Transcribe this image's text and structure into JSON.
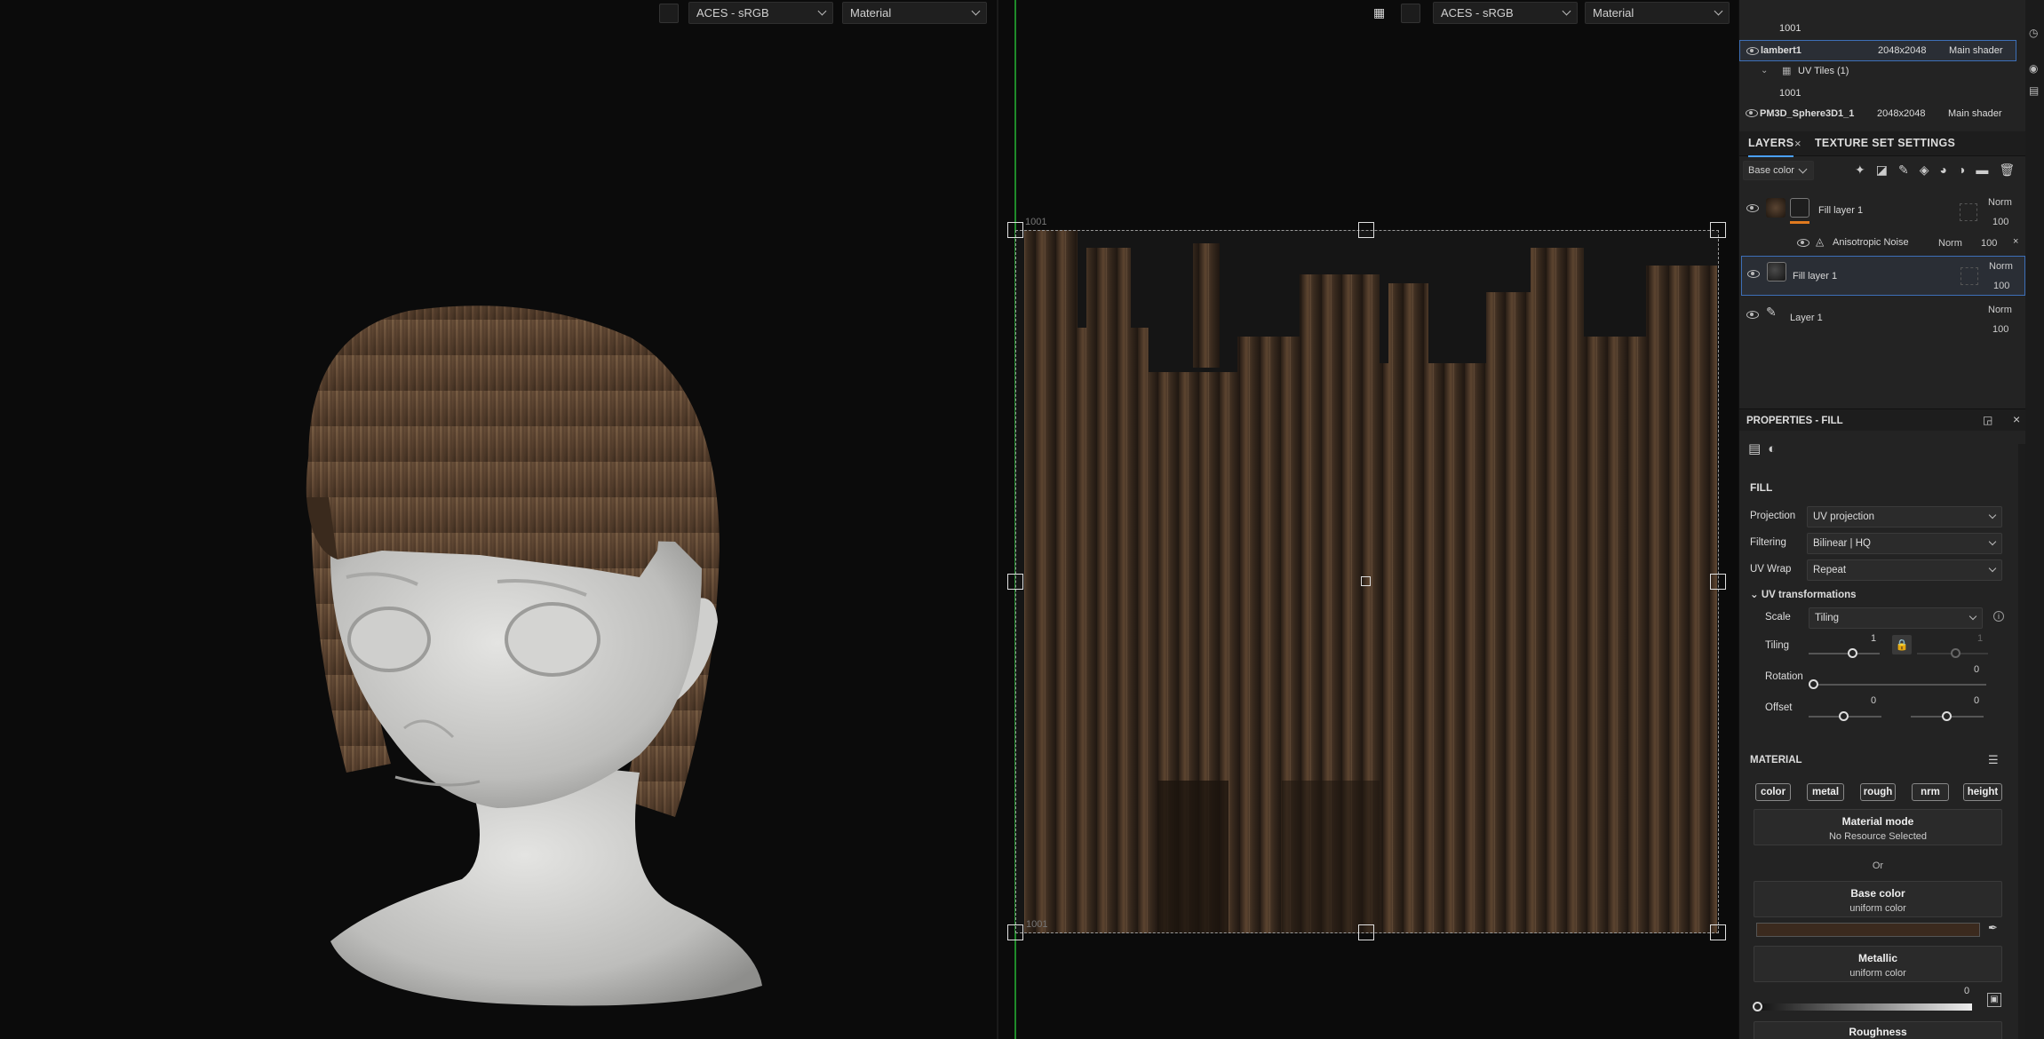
{
  "viewport3d": {
    "colorspace": "ACES - sRGB",
    "mode": "Material"
  },
  "viewport2d": {
    "colorspace": "ACES - sRGB",
    "mode": "Material",
    "tile_top": "1001",
    "tile_bottom": "1001"
  },
  "texture_sets": [
    {
      "type": "tile",
      "label": "1001"
    },
    {
      "type": "set",
      "name": "lambert1",
      "res": "2048x2048",
      "shader": "Main shader",
      "selected": true
    },
    {
      "type": "group",
      "label": "UV Tiles (1)"
    },
    {
      "type": "tile",
      "label": "1001"
    },
    {
      "type": "set",
      "name": "PM3D_Sphere3D1_1",
      "res": "2048x2048",
      "shader": "Main shader"
    }
  ],
  "tabs": {
    "layers": "LAYERS",
    "texture_set_settings": "TEXTURE SET SETTINGS"
  },
  "channel_select": "Base color",
  "layers": [
    {
      "name": "Fill layer 1",
      "blend": "Norm",
      "opacity": "100",
      "masked": true
    },
    {
      "name": "Anisotropic Noise",
      "blend": "Norm",
      "opacity": "100",
      "child": true
    },
    {
      "name": "Fill layer 1",
      "blend": "Norm",
      "opacity": "100",
      "selected": true
    },
    {
      "name": "Layer 1",
      "blend": "Norm",
      "opacity": "100"
    }
  ],
  "properties": {
    "title": "PROPERTIES - FILL",
    "section_fill": "FILL",
    "projection_label": "Projection",
    "projection": "UV projection",
    "filtering_label": "Filtering",
    "filtering": "Bilinear | HQ",
    "uvwrap_label": "UV Wrap",
    "uvwrap": "Repeat",
    "uvtrans_label": "UV transformations",
    "scale_label": "Scale",
    "scale": "Tiling",
    "tiling_label": "Tiling",
    "tiling_value": "1",
    "tiling_value2": "1",
    "rotation_label": "Rotation",
    "rotation_value": "0",
    "offset_label": "Offset",
    "offset_value1": "0",
    "offset_value2": "0",
    "section_material": "MATERIAL",
    "chips": [
      "color",
      "metal",
      "rough",
      "nrm",
      "height"
    ],
    "material_mode_title": "Material mode",
    "material_mode_sub": "No Resource Selected",
    "or": "Or",
    "base_color_title": "Base color",
    "base_color_sub": "uniform color",
    "metallic_title": "Metallic",
    "metallic_sub": "uniform color",
    "metallic_value": "0",
    "roughness_title": "Roughness"
  },
  "colors": {
    "accent": "#4aa0ff",
    "base_color_swatch": "#3b2a1e",
    "mask_orange": "#e07a1f",
    "uv_green": "#1f8a2a"
  }
}
